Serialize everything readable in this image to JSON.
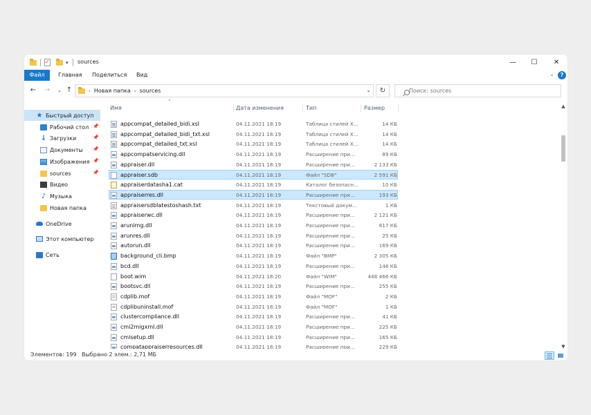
{
  "window": {
    "title": "sources",
    "controls": {
      "minimize": "—",
      "maximize": "☐",
      "close": "✕"
    }
  },
  "ribbon": {
    "tabs": [
      "Файл",
      "Главная",
      "Поделиться",
      "Вид"
    ],
    "help": "?"
  },
  "address": {
    "crumbs": [
      "Новая папка",
      "sources"
    ],
    "search_placeholder": "Поиск: sources"
  },
  "navpane": {
    "items": [
      {
        "label": "Быстрый доступ",
        "icon": "star-icon",
        "selected": true
      },
      {
        "label": "Рабочий стол",
        "icon": "desktop-icon",
        "pinned": true
      },
      {
        "label": "Загрузки",
        "icon": "download-icon",
        "pinned": true
      },
      {
        "label": "Документы",
        "icon": "documents-icon",
        "pinned": true
      },
      {
        "label": "Изображения",
        "icon": "pictures-icon",
        "pinned": true
      },
      {
        "label": "sources",
        "icon": "folder-icon",
        "pinned": true
      },
      {
        "label": "Видео",
        "icon": "video-icon"
      },
      {
        "label": "Музыка",
        "icon": "music-icon"
      },
      {
        "label": "Новая папка",
        "icon": "folder-icon"
      },
      {
        "label": "OneDrive",
        "icon": "cloud-icon"
      },
      {
        "label": "Этот компьютер",
        "icon": "computer-icon"
      },
      {
        "label": "Сеть",
        "icon": "network-icon"
      }
    ]
  },
  "columns": {
    "name": "Имя",
    "date": "Дата изменения",
    "type": "Тип",
    "size": "Размер"
  },
  "files": [
    {
      "name": "appcompat_detailed_bidi.xsl",
      "date": "04.11.2021 18:19",
      "type": "Таблица стилей X...",
      "size": "14 КБ",
      "kind": "xsl"
    },
    {
      "name": "appcompat_detailed_bidi_txt.xsl",
      "date": "04.11.2021 18:19",
      "type": "Таблица стилей X...",
      "size": "14 КБ",
      "kind": "xsl"
    },
    {
      "name": "appcompat_detailed_txt.xsl",
      "date": "04.11.2021 18:19",
      "type": "Таблица стилей X...",
      "size": "14 КБ",
      "kind": "xsl"
    },
    {
      "name": "appcompatservicing.dll",
      "date": "04.11.2021 18:19",
      "type": "Расширение при...",
      "size": "89 КБ",
      "kind": "dll"
    },
    {
      "name": "appraiser.dll",
      "date": "04.11.2021 18:19",
      "type": "Расширение при...",
      "size": "2 133 КБ",
      "kind": "dll"
    },
    {
      "name": "appraiser.sdb",
      "date": "04.11.2021 18:19",
      "type": "Файл \"SDB\"",
      "size": "2 591 КБ",
      "kind": "sdb",
      "selected": true
    },
    {
      "name": "appraiserdatasha1.cat",
      "date": "04.11.2021 18:19",
      "type": "Каталог безопасн...",
      "size": "10 КБ",
      "kind": "cat"
    },
    {
      "name": "appraiserres.dll",
      "date": "04.11.2021 18:19",
      "type": "Расширение при...",
      "size": "193 КБ",
      "kind": "dll",
      "selected": true
    },
    {
      "name": "appraisersdblatestoshash.txt",
      "date": "04.11.2021 18:19",
      "type": "Текстовый докум...",
      "size": "1 КБ",
      "kind": "txt"
    },
    {
      "name": "appraiserwc.dll",
      "date": "04.11.2021 18:19",
      "type": "Расширение при...",
      "size": "2 121 КБ",
      "kind": "dll"
    },
    {
      "name": "arunimg.dll",
      "date": "04.11.2021 18:19",
      "type": "Расширение при...",
      "size": "817 КБ",
      "kind": "dll"
    },
    {
      "name": "arunres.dll",
      "date": "04.11.2021 18:19",
      "type": "Расширение при...",
      "size": "25 КБ",
      "kind": "dll"
    },
    {
      "name": "autorun.dll",
      "date": "04.11.2021 18:19",
      "type": "Расширение при...",
      "size": "169 КБ",
      "kind": "dll"
    },
    {
      "name": "background_cli.bmp",
      "date": "04.11.2021 18:19",
      "type": "Файл \"BMP\"",
      "size": "2 305 КБ",
      "kind": "bmp"
    },
    {
      "name": "bcd.dll",
      "date": "04.11.2021 18:19",
      "type": "Расширение при...",
      "size": "146 КБ",
      "kind": "dll"
    },
    {
      "name": "boot.wim",
      "date": "04.11.2021 18:20",
      "type": "Файл \"WIM\"",
      "size": "448 466 КБ",
      "kind": "wim"
    },
    {
      "name": "bootsvc.dll",
      "date": "04.11.2021 18:19",
      "type": "Расширение при...",
      "size": "255 КБ",
      "kind": "dll"
    },
    {
      "name": "cdplib.mof",
      "date": "04.11.2021 18:19",
      "type": "Файл \"MOF\"",
      "size": "2 КБ",
      "kind": "mof"
    },
    {
      "name": "cdplibuninstall.mof",
      "date": "04.11.2021 18:19",
      "type": "Файл \"MOF\"",
      "size": "1 КБ",
      "kind": "mof"
    },
    {
      "name": "clustercompliance.dll",
      "date": "04.11.2021 18:19",
      "type": "Расширение при...",
      "size": "41 КБ",
      "kind": "dll"
    },
    {
      "name": "cmi2migxml.dll",
      "date": "04.11.2021 18:19",
      "type": "Расширение при...",
      "size": "225 КБ",
      "kind": "dll"
    },
    {
      "name": "cmisetup.dll",
      "date": "04.11.2021 18:19",
      "type": "Расширение при...",
      "size": "165 КБ",
      "kind": "dll"
    },
    {
      "name": "compatappraiserresources.dll",
      "date": "04.11.2021 18:19",
      "type": "Расширение при...",
      "size": "229 КБ",
      "kind": "dll"
    }
  ],
  "status": {
    "count": "Элементов: 199",
    "selection": "Выбрано 2 элем.: 2,71 МБ"
  },
  "colors": {
    "accent": "#1979ca",
    "selection": "#cce8ff",
    "selection_border": "#99d1ff"
  }
}
